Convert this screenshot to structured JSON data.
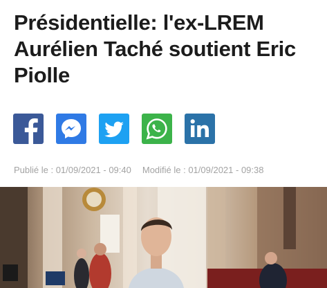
{
  "article": {
    "title_line1": "Présidentielle: l'ex-LREM",
    "title_line2": "Aurélien Taché soutient Eric",
    "title_line3": "Piolle",
    "published": "Publié le : 01/09/2021 - 09:40",
    "modified": "Modifié le : 01/09/2021 - 09:38"
  },
  "share": [
    {
      "network": "facebook",
      "icon": "facebook-icon",
      "color": "#3b5998"
    },
    {
      "network": "messenger",
      "icon": "messenger-icon",
      "color": "#2f7ae5"
    },
    {
      "network": "twitter",
      "icon": "twitter-icon",
      "color": "#1da1f2"
    },
    {
      "network": "whatsapp",
      "icon": "whatsapp-icon",
      "color": "#3cb34a"
    },
    {
      "network": "linkedin",
      "icon": "linkedin-icon",
      "color": "#2b72a8"
    }
  ],
  "colors": {
    "headline": "#1c1c1c",
    "meta": "#a3a3a3"
  }
}
